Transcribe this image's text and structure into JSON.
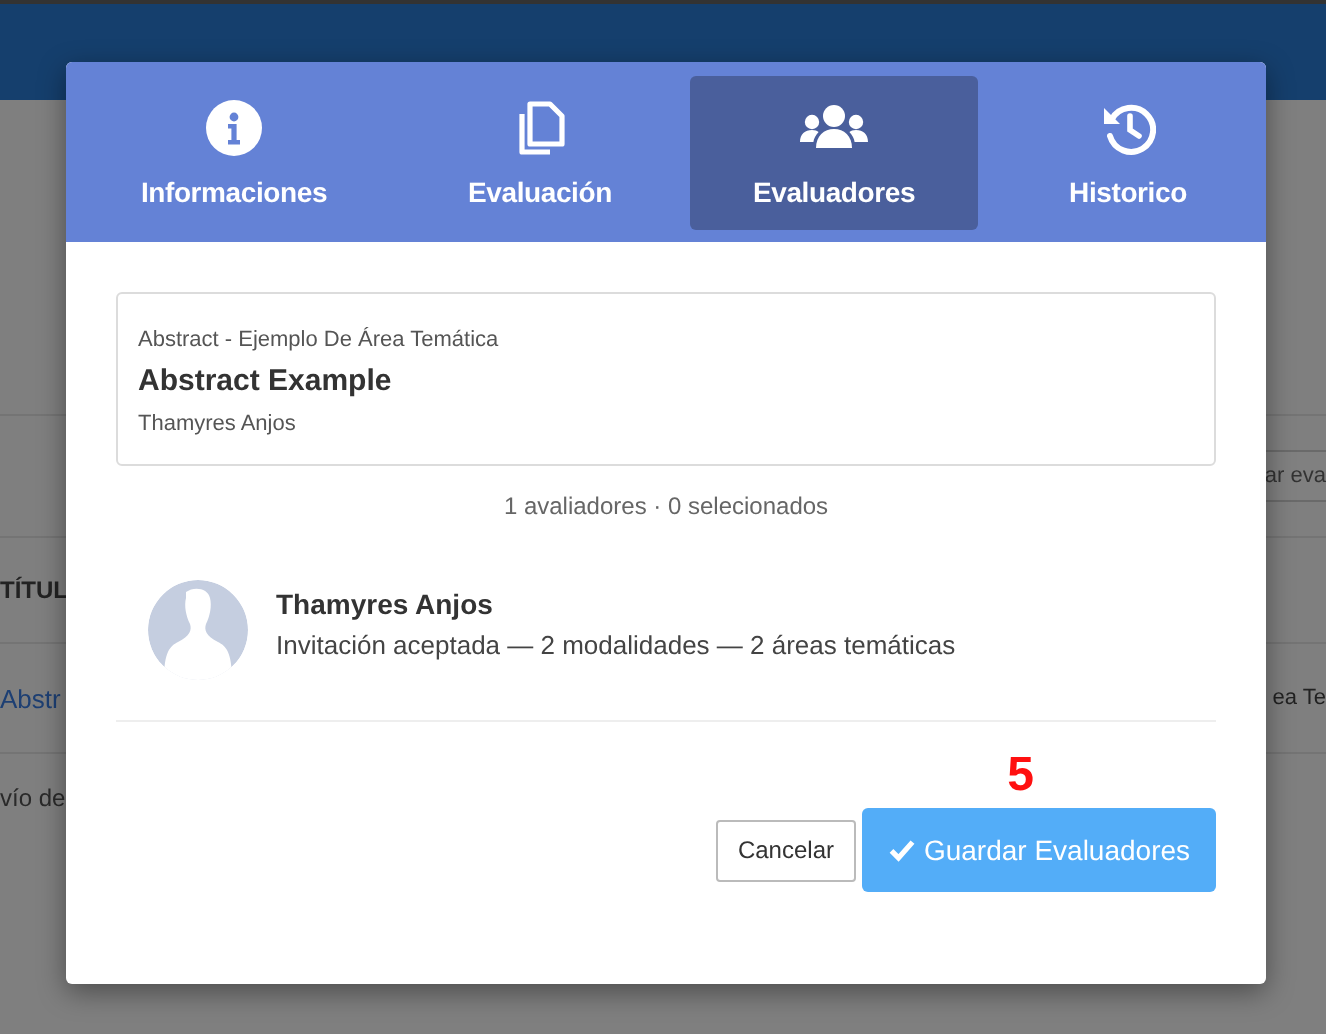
{
  "background": {
    "table_heading": "TÍTUL",
    "row_link": "Abstr",
    "footer_text": "vío de",
    "action_button": "ar eva",
    "row_cell": "ea Te"
  },
  "modal": {
    "tabs": [
      {
        "label": "Informaciones",
        "kind": "info",
        "selected": false
      },
      {
        "label": "Evaluación",
        "kind": "copy",
        "selected": false
      },
      {
        "label": "Evaluadores",
        "kind": "users",
        "selected": true
      },
      {
        "label": "Historico",
        "kind": "history",
        "selected": false
      }
    ],
    "work": {
      "area": "Abstract - Ejemplo De Área Temática",
      "title": "Abstract Example",
      "author": "Thamyres Anjos"
    },
    "count": "1 avaliadores · 0 selecionados",
    "reviewers": [
      {
        "name": "Thamyres Anjos",
        "details": "Invitación aceptada — 2 modalidades — 2 áreas temáticas"
      }
    ],
    "buttons": {
      "cancel": "Cancelar",
      "save": "Guardar Evaluadores"
    },
    "annotation": "5"
  }
}
